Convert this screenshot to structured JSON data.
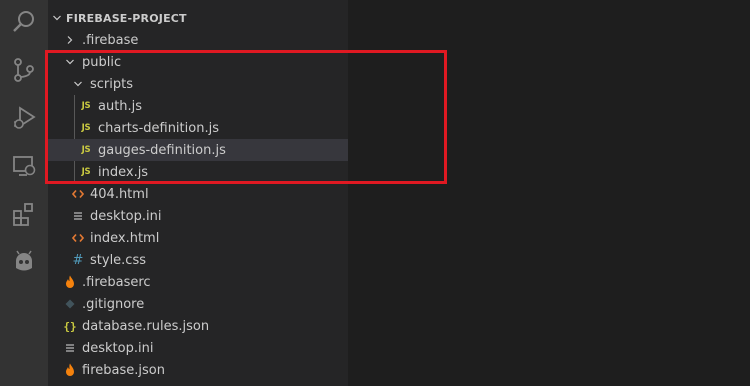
{
  "explorer": {
    "project_title": "FIREBASE-PROJECT",
    "items": [
      {
        "label": ".firebase",
        "type": "folder",
        "expanded": false
      },
      {
        "label": "public",
        "type": "folder",
        "expanded": true
      },
      {
        "label": "scripts",
        "type": "folder",
        "expanded": true
      },
      {
        "label": "auth.js",
        "type": "js-file"
      },
      {
        "label": "charts-definition.js",
        "type": "js-file"
      },
      {
        "label": "gauges-definition.js",
        "type": "js-file",
        "selected": true
      },
      {
        "label": "index.js",
        "type": "js-file"
      },
      {
        "label": "404.html",
        "type": "html-file"
      },
      {
        "label": "desktop.ini",
        "type": "ini-file"
      },
      {
        "label": "index.html",
        "type": "html-file"
      },
      {
        "label": "style.css",
        "type": "css-file"
      },
      {
        "label": ".firebaserc",
        "type": "firebase-file"
      },
      {
        "label": ".gitignore",
        "type": "git-file"
      },
      {
        "label": "database.rules.json",
        "type": "json-file"
      },
      {
        "label": "desktop.ini",
        "type": "ini-file"
      },
      {
        "label": "firebase.json",
        "type": "firebase-file"
      }
    ]
  },
  "icons": {
    "js_badge": "JS",
    "json_badge": "{}",
    "css_badge": "#"
  },
  "colors": {
    "activity_bar": "#333333",
    "sidebar": "#252526",
    "editor": "#1e1e1e",
    "selection": "#37373d",
    "highlight_box": "#e01922",
    "js": "#cbcb41",
    "html": "#e37933",
    "css": "#519aba",
    "firebase": "#f5820d"
  }
}
